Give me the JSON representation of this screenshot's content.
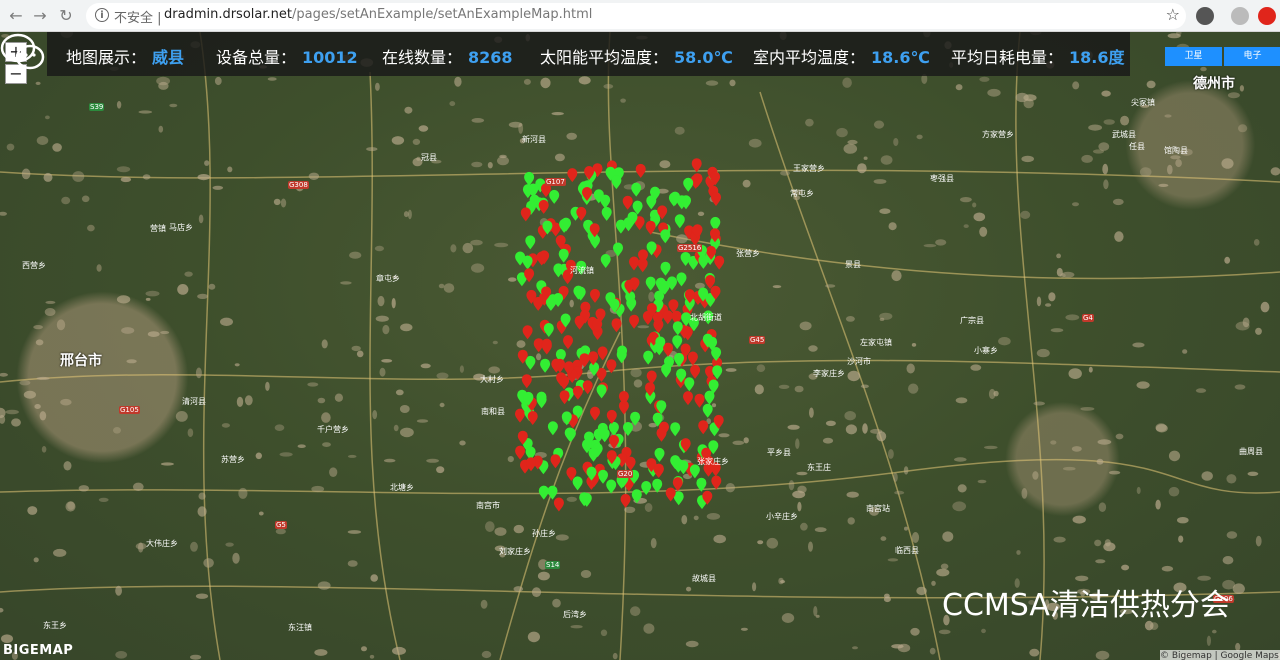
{
  "browser": {
    "insecure_label": "不安全",
    "host": "dradmin.drsolar.net",
    "path": "/pages/setAnExample/setAnExampleMap.html"
  },
  "stats": {
    "map_label": "地图展示：",
    "map_value": "威县",
    "devices_label": "设备总量：",
    "devices_value": "10012",
    "online_label": "在线数量：",
    "online_value": "8268",
    "solar_temp_label": "太阳能平均温度：",
    "solar_temp_value": "58.0℃",
    "indoor_temp_label": "室内平均温度：",
    "indoor_temp_value": "18.6℃",
    "power_label": "平均日耗电量：",
    "power_value": "18.6度"
  },
  "map_controls": {
    "zoom_in": "+",
    "zoom_out": "−",
    "satellite": "卫星",
    "electronic": "电子"
  },
  "colors": {
    "online_marker": "#33ee33",
    "offline_marker": "#e0251b",
    "stat_value": "#3ea0f0"
  },
  "watermark": "CCMSA清洁供热分会",
  "logo": "BIGEMAP",
  "attribution": "© Bigemap | Google Maps",
  "cities": [
    {
      "name": "邢台市"
    },
    {
      "name": "德州市"
    }
  ],
  "places": [
    "北塘乡",
    "大伟庄乡",
    "千户营乡",
    "大村乡",
    "方家营乡",
    "左家屯镇",
    "南宫市",
    "张家庄乡",
    "小寨乡",
    "李家庄乡",
    "西营乡",
    "王家营乡",
    "营镇",
    "张营乡",
    "苏营乡",
    "东王庄",
    "小辛庄乡",
    "后湾乡",
    "常屯乡",
    "章屯乡",
    "北胡街道",
    "广宗县",
    "刘家庄乡",
    "东王乡",
    "河流镇",
    "任县",
    "东汪镇",
    "沙河市",
    "南和县",
    "平乡县",
    "新河县",
    "清河县",
    "枣强县",
    "武城县",
    "故城县",
    "景县",
    "临西县",
    "曲周县",
    "馆陶县",
    "冠县",
    "南宫站",
    "孙庄乡",
    "马店乡",
    "尖冢镇"
  ],
  "roads": [
    "G308",
    "G106",
    "G45",
    "G107",
    "G4",
    "G2516",
    "G105",
    "S39",
    "G20",
    "S14",
    "G5"
  ]
}
